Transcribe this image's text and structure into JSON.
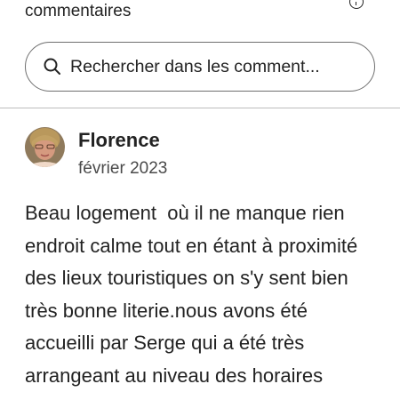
{
  "header": {
    "title": "commentaires",
    "info_icon": "info-icon"
  },
  "search": {
    "icon": "search-icon",
    "placeholder": "Rechercher dans les comment..."
  },
  "reviews": [
    {
      "avatar": "avatar",
      "name": "Florence",
      "date": "février 2023",
      "text": "Beau logement  où il ne manque rien endroit calme tout en étant à proximité des lieux touristiques on s'y sent bien très bonne literie.nous avons été accueilli par Serge qui a été très arrangeant au niveau des horaires"
    }
  ]
}
